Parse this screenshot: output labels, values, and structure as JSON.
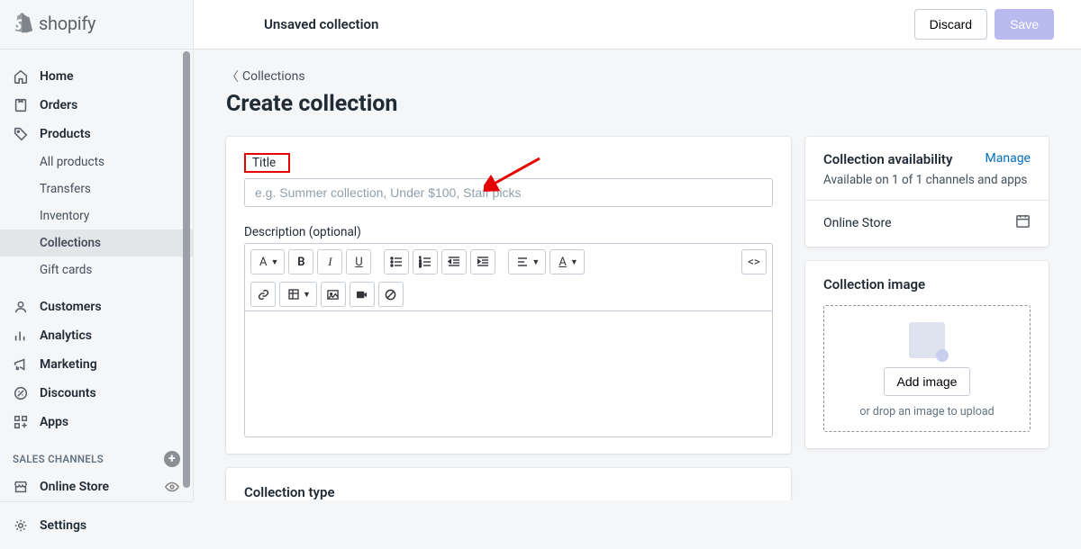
{
  "brand": {
    "name": "shopify"
  },
  "topbar": {
    "status": "Unsaved collection",
    "discard": "Discard",
    "save": "Save"
  },
  "nav": {
    "home": "Home",
    "orders": "Orders",
    "products": "Products",
    "all_products": "All products",
    "transfers": "Transfers",
    "inventory": "Inventory",
    "collections": "Collections",
    "gift_cards": "Gift cards",
    "customers": "Customers",
    "analytics": "Analytics",
    "marketing": "Marketing",
    "discounts": "Discounts",
    "apps": "Apps",
    "channels_header": "SALES CHANNELS",
    "online_store": "Online Store",
    "settings": "Settings"
  },
  "page": {
    "breadcrumb": "Collections",
    "title": "Create collection"
  },
  "form": {
    "title_label": "Title",
    "title_placeholder": "e.g. Summer collection, Under $100, Staff picks",
    "desc_label": "Description (optional)",
    "collection_type_header": "Collection type"
  },
  "rte": {
    "format": "A",
    "bold": "B",
    "italic": "I",
    "underline": "U",
    "align_default": "≡"
  },
  "availability": {
    "header": "Collection availability",
    "manage": "Manage",
    "subtitle": "Available on 1 of 1 channels and apps",
    "channel": "Online Store"
  },
  "image": {
    "header": "Collection image",
    "add_button": "Add image",
    "drop_text": "or drop an image to upload"
  }
}
